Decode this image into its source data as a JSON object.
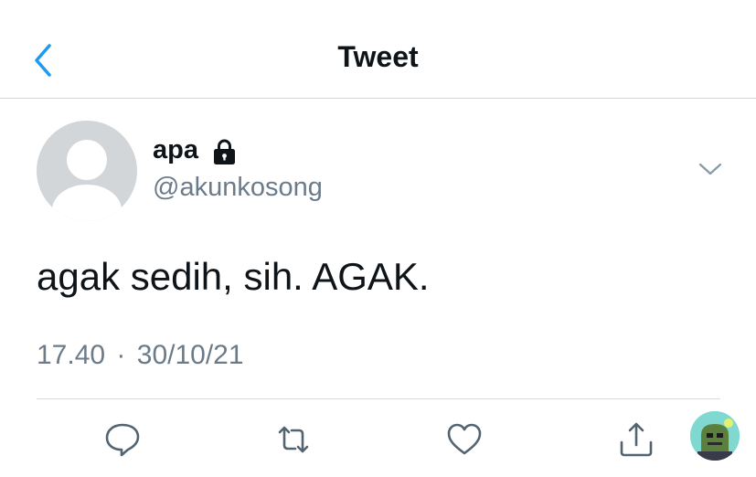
{
  "header": {
    "title": "Tweet",
    "back_icon": "chevron-left-icon",
    "accent": "#1d9bf0"
  },
  "tweet": {
    "author_name": "apa",
    "protected_icon": "lock-icon",
    "handle": "@akunkosong",
    "text": "agak sedih, sih. AGAK.",
    "time": "17.40",
    "separator": "·",
    "date": "30/10/21"
  },
  "actions": {
    "reply_icon": "reply-icon",
    "retweet_icon": "retweet-icon",
    "like_icon": "heart-icon",
    "share_icon": "share-icon"
  },
  "colors": {
    "text": "#0f1419",
    "secondary": "#6b7b89",
    "divider": "#cfd5da"
  }
}
